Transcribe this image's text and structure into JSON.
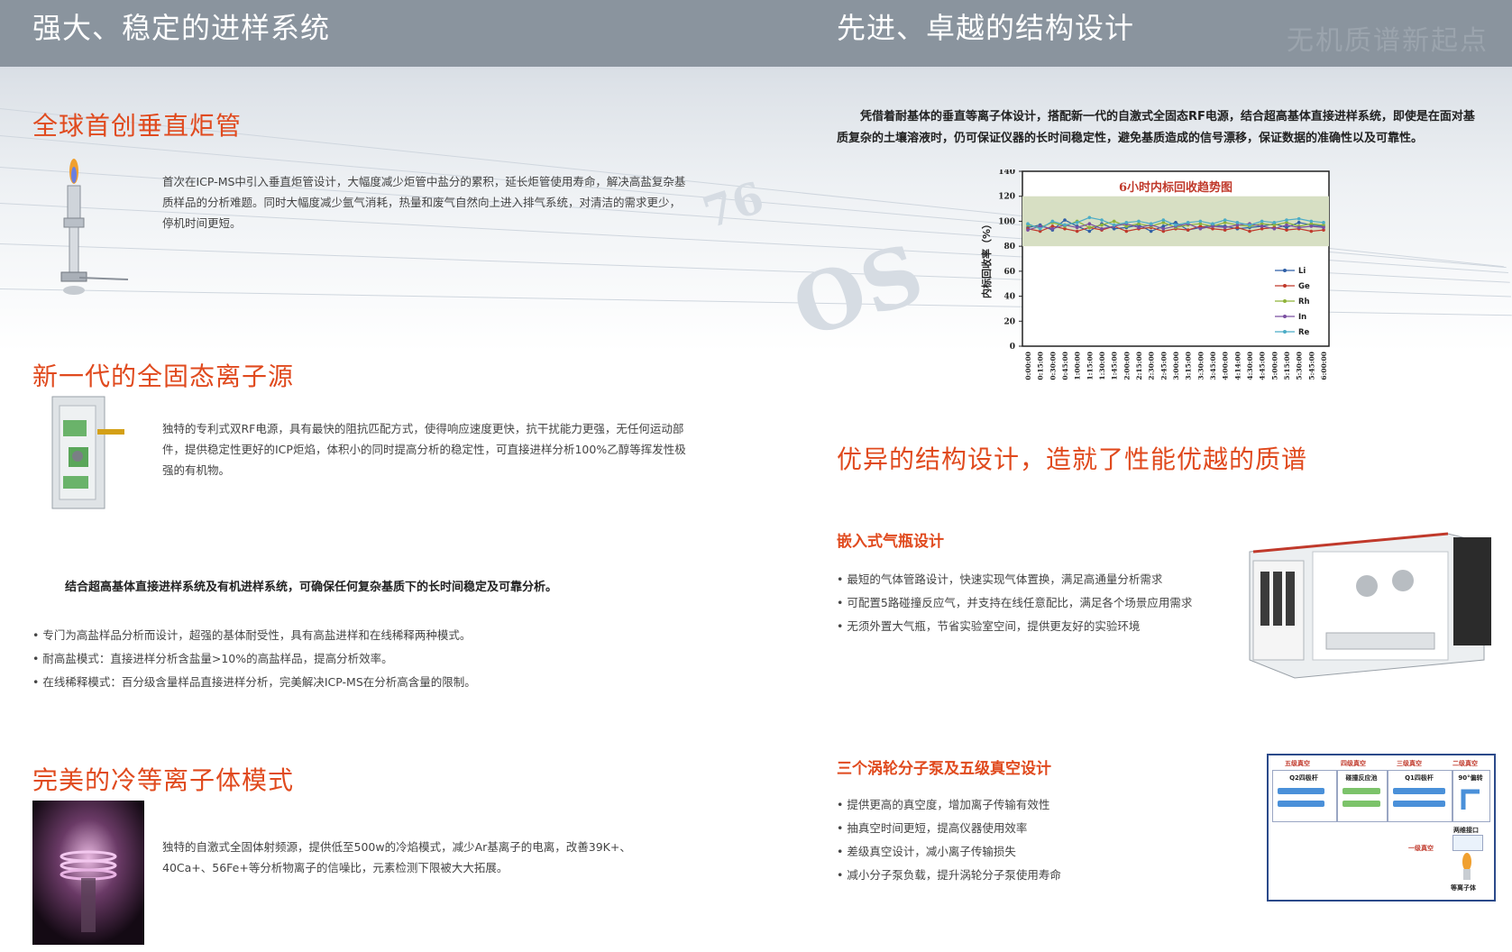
{
  "header": {
    "left_title": "强大、稳定的进样系统",
    "right_title": "先进、卓越的结构设计",
    "watermark": "无机质谱新起点"
  },
  "left": {
    "torch": {
      "title": "全球首创垂直炬管",
      "text": "首次在ICP-MS中引入垂直炬管设计，大幅度减少炬管中盐分的累积，延长炬管使用寿命，解决高盐复杂基质样品的分析难题。同时大幅度减少氩气消耗，热量和废气自然向上进入排气系统，对清洁的需求更少，停机时间更短。"
    },
    "rf": {
      "title": "新一代的全固态离子源",
      "text": "独特的专利式双RF电源，具有最快的阻抗匹配方式，使得响应速度更快，抗干扰能力更强，无任何运动部件，提供稳定性更好的ICP炬焰，体积小的同时提高分析的稳定性，可直接进样分析100%乙醇等挥发性极强的有机物。"
    },
    "summary": "结合超高基体直接进样系统及有机进样系统，可确保任何复杂基质下的长时间稳定及可靠分析。",
    "bullets": [
      "专门为高盐样品分析而设计，超强的基体耐受性，具有高盐进样和在线稀释两种模式。",
      "耐高盐模式：直接进样分析含盐量>10%的高盐样品，提高分析效率。",
      "在线稀释模式：百分级含量样品直接进样分析，完美解决ICP-MS在分析高含量的限制。"
    ],
    "cold": {
      "title": "完美的冷等离子体模式",
      "text": "独特的自激式全固体射频源，提供低至500w的冷焰模式，减少Ar基离子的电离，改善39K+、40Ca+、56Fe+等分析物离子的信噪比，元素检测下限被大大拓展。"
    }
  },
  "right": {
    "intro": "凭借着耐基体的垂直等离子体设计，搭配新一代的自激式全固态RF电源，结合超高基体直接进样系统，即使是在面对基质复杂的土壤溶液时，仍可保证仪器的长时间稳定性，避免基质造成的信号漂移，保证数据的准确性以及可靠性。",
    "perf_title": "优异的结构设计，造就了性能优越的质谱",
    "gas": {
      "title": "嵌入式气瓶设计",
      "bullets": [
        "最短的气体管路设计，快速实现气体置换，满足高通量分析需求",
        "可配置5路碰撞反应气，并支持在线任意配比，满足各个场景应用需求",
        "无须外置大气瓶，节省实验室空间，提供更友好的实验环境"
      ]
    },
    "vacuum": {
      "title": "三个涡轮分子泵及五级真空设计",
      "bullets": [
        "提供更高的真空度，增加离子传输有效性",
        "抽真空时间更短，提高仪器使用效率",
        "差级真空设计，减小离子传输损失",
        "减小分子泵负载，提升涡轮分子泵使用寿命"
      ],
      "diagram": {
        "stages": [
          "五级真空",
          "四级真空",
          "三级真空",
          "二级真空"
        ],
        "parts": [
          "Q2四极杆",
          "碰撞反应池",
          "Q1四极杆",
          "90°偏转"
        ],
        "interface": "两维接口",
        "stage1": "一级真空",
        "plasma": "等离子体"
      }
    }
  },
  "chart_data": {
    "type": "line",
    "title": "6小时内标回收趋势图",
    "ylabel": "内标回收率（%）",
    "xlabel": "",
    "ylim": [
      0,
      140
    ],
    "yticks": [
      0,
      20,
      40,
      60,
      80,
      100,
      120,
      140
    ],
    "band": [
      80,
      120
    ],
    "band_color": "#d7dfc3",
    "categories": [
      "0:00:00",
      "0:15:00",
      "0:30:00",
      "0:45:00",
      "1:00:00",
      "1:15:00",
      "1:30:00",
      "1:45:00",
      "2:00:00",
      "2:15:00",
      "2:30:00",
      "2:45:00",
      "3:00:00",
      "3:15:00",
      "3:30:00",
      "3:45:00",
      "4:00:00",
      "4:14:00",
      "4:30:00",
      "4:45:00",
      "5:00:00",
      "5:15:00",
      "5:30:00",
      "5:45:00",
      "6:00:00"
    ],
    "series": [
      {
        "name": "Li",
        "color": "#2f5fa6",
        "values": [
          95,
          97,
          93,
          101,
          96,
          92,
          98,
          94,
          95,
          97,
          92,
          96,
          99,
          93,
          95,
          97,
          96,
          94,
          95,
          96,
          98,
          95,
          99,
          97,
          96
        ]
      },
      {
        "name": "Ge",
        "color": "#c0392b",
        "values": [
          94,
          92,
          96,
          94,
          92,
          95,
          93,
          96,
          92,
          94,
          95,
          92,
          94,
          93,
          96,
          94,
          93,
          95,
          92,
          94,
          95,
          93,
          94,
          92,
          93
        ]
      },
      {
        "name": "Rh",
        "color": "#8fb339",
        "values": [
          97,
          95,
          99,
          96,
          100,
          95,
          97,
          100,
          96,
          98,
          96,
          99,
          95,
          97,
          98,
          96,
          99,
          97,
          96,
          98,
          97,
          99,
          96,
          98,
          97
        ]
      },
      {
        "name": "In",
        "color": "#7a4fa0",
        "values": [
          93,
          96,
          94,
          97,
          95,
          98,
          94,
          96,
          98,
          95,
          97,
          94,
          96,
          98,
          94,
          96,
          95,
          97,
          98,
          96,
          94,
          97,
          95,
          96,
          95
        ]
      },
      {
        "name": "Re",
        "color": "#4bacc6",
        "values": [
          98,
          94,
          100,
          97,
          99,
          103,
          101,
          97,
          99,
          100,
          98,
          101,
          97,
          99,
          100,
          98,
          101,
          99,
          97,
          100,
          99,
          101,
          102,
          100,
          99
        ]
      }
    ],
    "legend": "right"
  }
}
